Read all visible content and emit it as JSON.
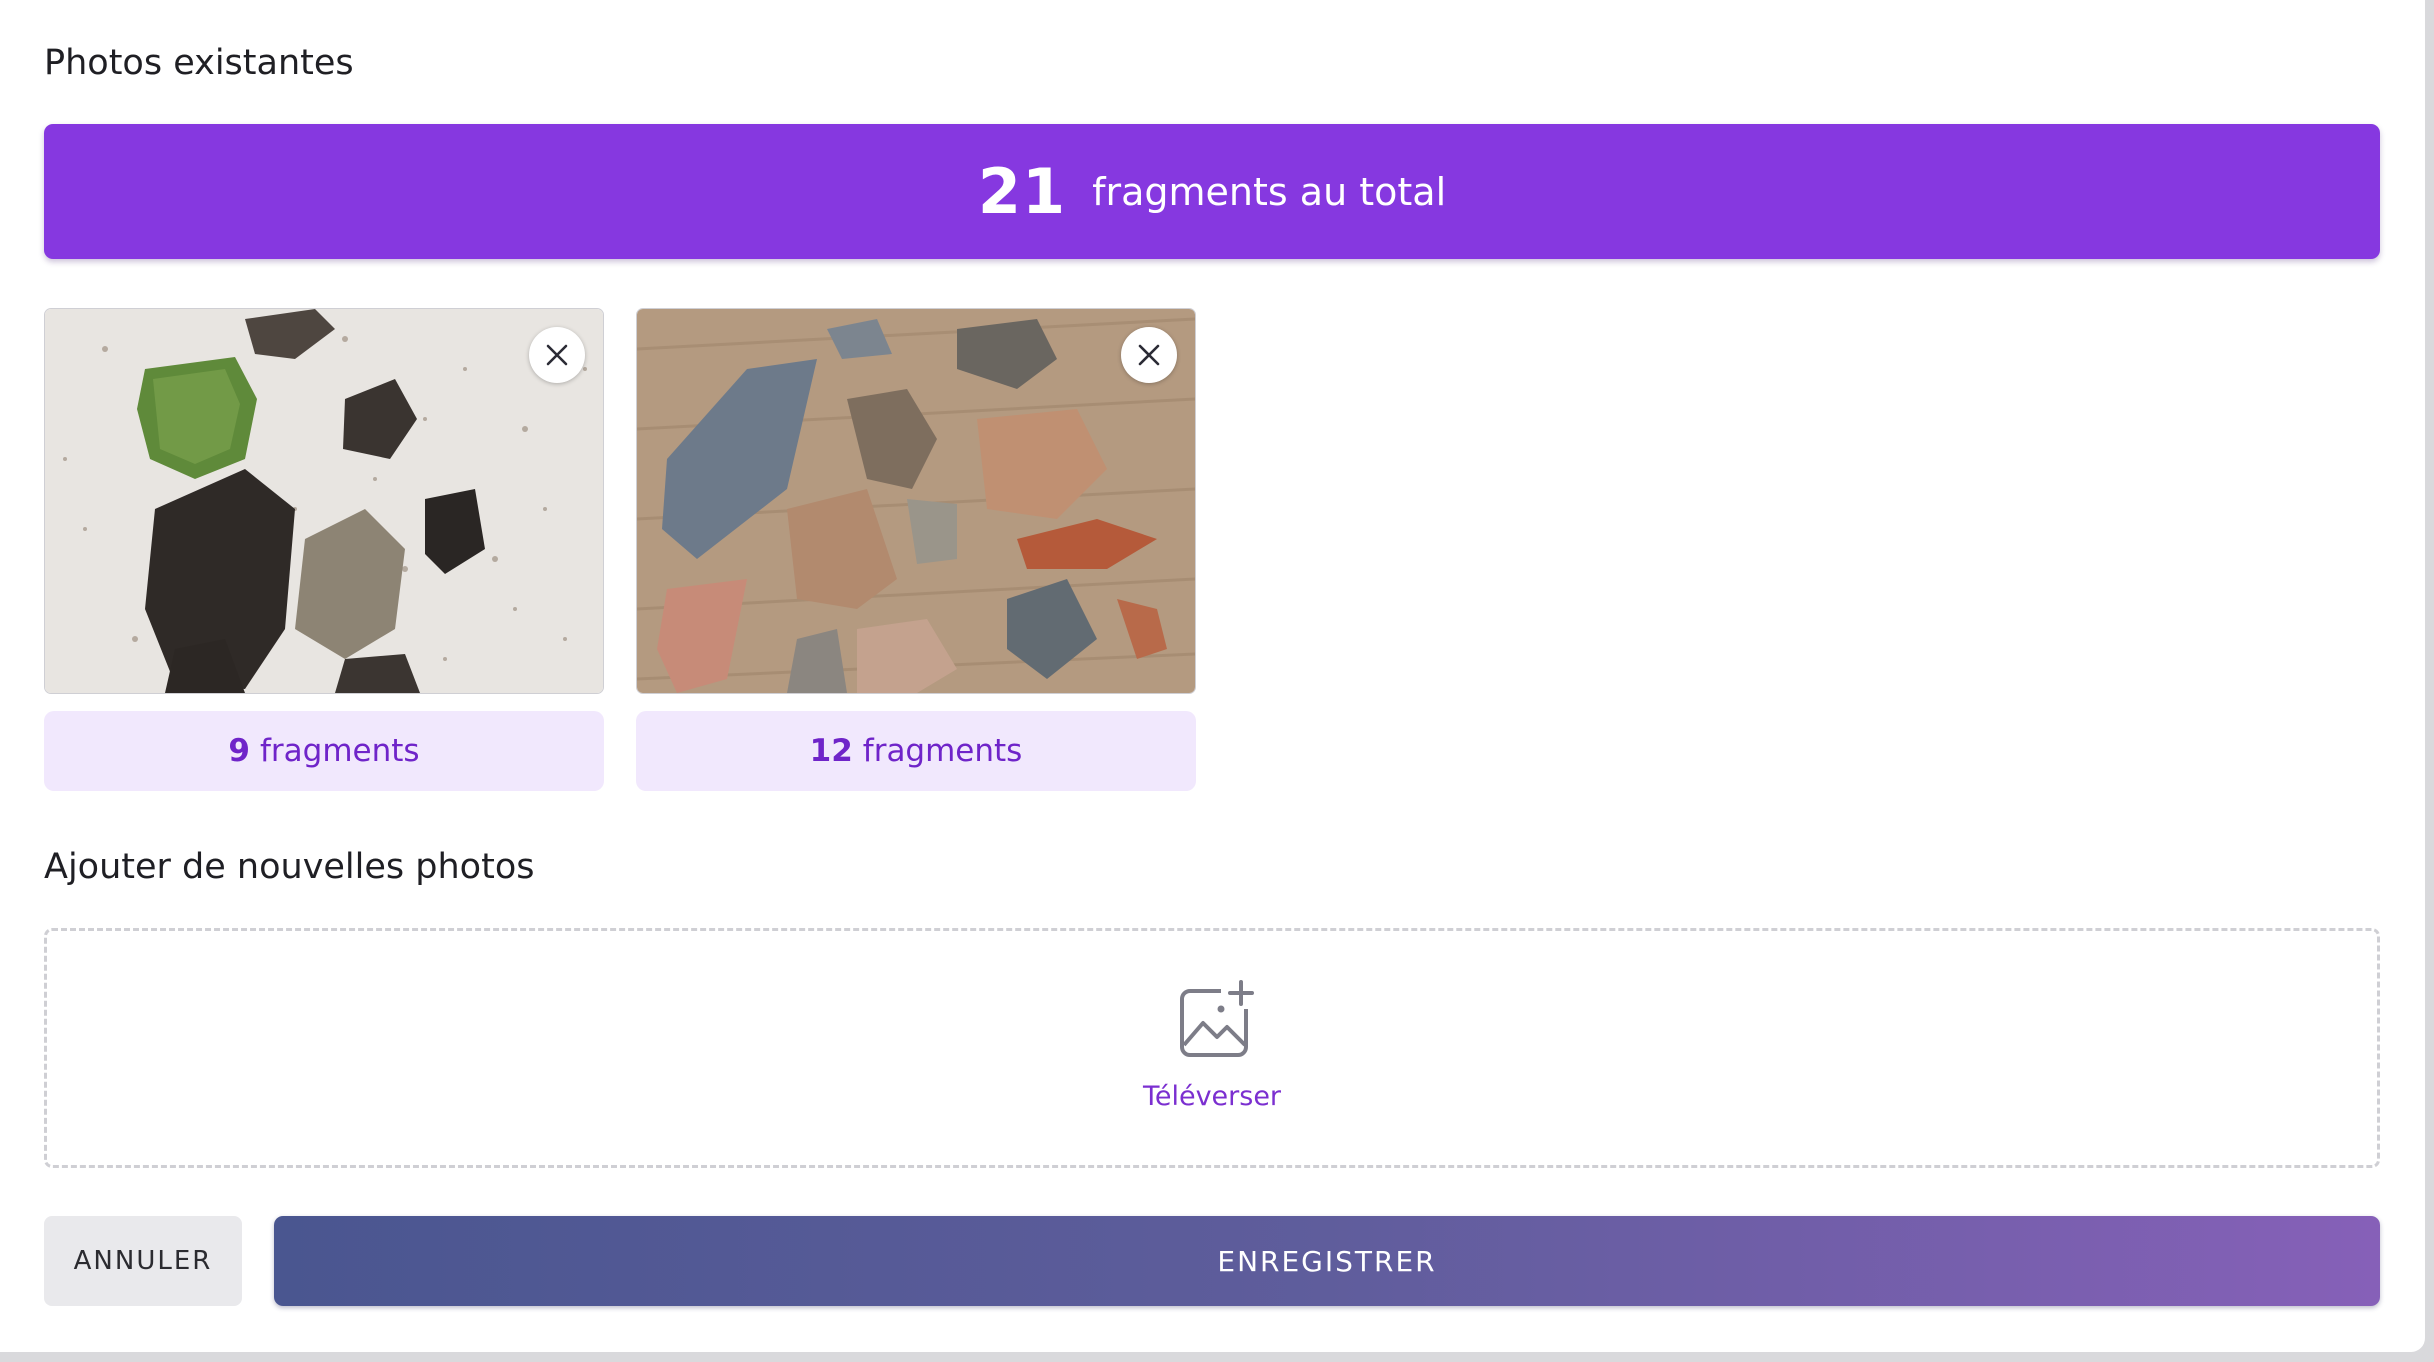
{
  "existing": {
    "title": "Photos existantes",
    "total_count": "21",
    "total_label": "fragments au total"
  },
  "photos": [
    {
      "count": "9",
      "count_label": "fragments",
      "thumb_bg": "#e9e6e2"
    },
    {
      "count": "12",
      "count_label": "fragments",
      "thumb_bg": "#b89e83"
    }
  ],
  "add": {
    "title": "Ajouter de nouvelles photos",
    "upload_label": "Téléverser"
  },
  "actions": {
    "cancel_label": "ANNULER",
    "save_label": "ENREGISTRER"
  },
  "colors": {
    "accent": "#8638e0",
    "pill_bg": "#f1e8fd",
    "pill_text": "#6f24c9",
    "save_gradient_start": "#4a5690",
    "save_gradient_end": "#8660b8"
  }
}
